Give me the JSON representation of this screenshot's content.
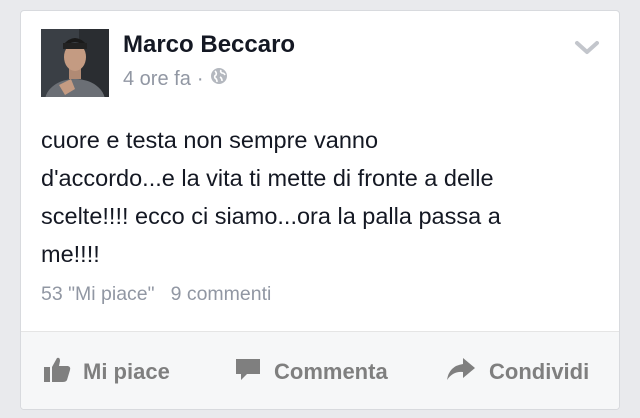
{
  "post": {
    "author": "Marco Beccaro",
    "time": "4 ore fa",
    "separator": "·",
    "privacy_icon": "globe-icon",
    "options_icon": "chevron-down-icon",
    "text": "cuore e testa non sempre vanno\nd'accordo...e la vita ti mette di fronte a delle\nscelte!!!! ecco ci siamo...ora la palla passa a\nme!!!!",
    "likes": "53 \"Mi piace\"",
    "comments": "9 commenti"
  },
  "actions": {
    "like": {
      "label": "Mi piace",
      "icon": "thumbs-up-icon"
    },
    "comment": {
      "label": "Commenta",
      "icon": "speech-bubble-icon"
    },
    "share": {
      "label": "Condividi",
      "icon": "share-arrow-icon"
    }
  },
  "colors": {
    "background": "#e9eaed",
    "name": "#141823",
    "meta": "#9197a3",
    "action": "#7f7f7f"
  }
}
